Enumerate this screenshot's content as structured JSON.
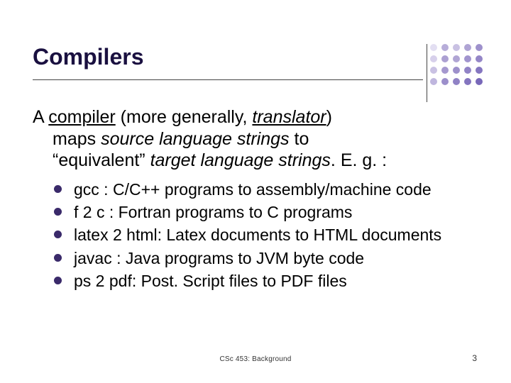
{
  "title": "Compilers",
  "intro": {
    "line1_pre": "A ",
    "compiler": "compiler",
    "line1_mid": "  (more generally, ",
    "translator": "translator",
    "line1_post": ")",
    "line2": "maps ",
    "source_phrase": "source language strings",
    "line2_post": " to",
    "line3": "“equivalent” ",
    "target_phrase": "target language strings",
    "line3_post": ".  E. g. :"
  },
  "bullets": [
    "gcc : C/C++ programs to assembly/machine code",
    "f 2 c : Fortran programs to C programs",
    "latex 2 html: Latex documents to HTML documents",
    "javac : Java programs to JVM byte code",
    "ps 2 pdf: Post. Script files to PDF files"
  ],
  "footer_center": "CSc 453: Background",
  "footer_right": "3",
  "dot_colors": [
    "#e3dff2",
    "#b7add9",
    "#c9c1e3",
    "#afa4d4",
    "#9e91cc",
    "#d7d0eb",
    "#aca0d2",
    "#b0a5d4",
    "#a194ce",
    "#9486c7",
    "#c9c1e3",
    "#a598cf",
    "#9d90cb",
    "#9183c6",
    "#8576c0",
    "#bfb6de",
    "#9c8fcb",
    "#9082c5",
    "#8475bf",
    "#7868b9"
  ]
}
